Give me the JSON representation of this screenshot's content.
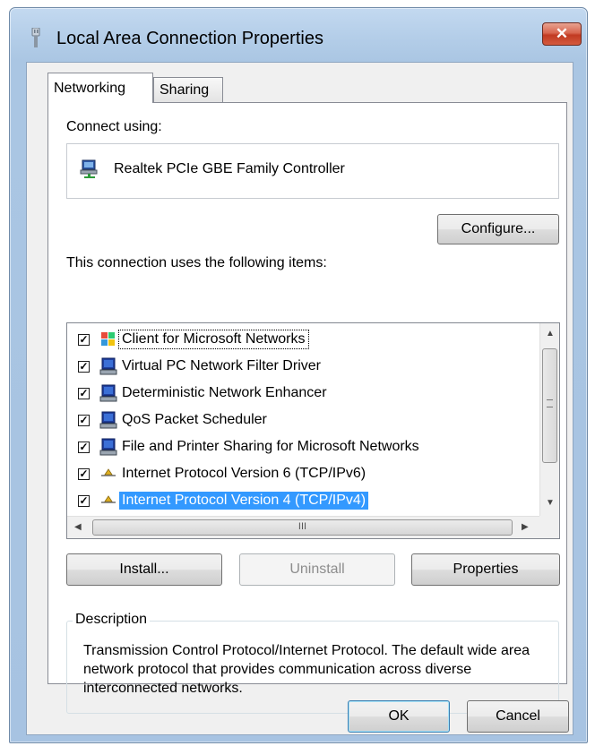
{
  "window": {
    "title": "Local Area Connection Properties",
    "close_glyph": "✕"
  },
  "tabs": [
    {
      "label": "Networking",
      "active": true
    },
    {
      "label": "Sharing",
      "active": false
    }
  ],
  "connect_using": {
    "label": "Connect using:",
    "adapter": "Realtek PCIe GBE Family Controller",
    "adapter_icon": "network-adapter-icon"
  },
  "configure_button": "Configure...",
  "items_label": "This connection uses the following items:",
  "items": [
    {
      "label": "Client for Microsoft Networks",
      "checked": true,
      "icon": "network-client-icon"
    },
    {
      "label": "Virtual PC Network Filter Driver",
      "checked": true,
      "icon": "computer-service-icon"
    },
    {
      "label": "Deterministic Network Enhancer",
      "checked": true,
      "icon": "computer-service-icon"
    },
    {
      "label": "QoS Packet Scheduler",
      "checked": true,
      "icon": "computer-service-icon"
    },
    {
      "label": "File and Printer Sharing for Microsoft Networks",
      "checked": true,
      "icon": "computer-service-icon"
    },
    {
      "label": "Internet Protocol Version 6 (TCP/IPv6)",
      "checked": true,
      "icon": "protocol-icon"
    },
    {
      "label": "Internet Protocol Version 4 (TCP/IPv4)",
      "checked": true,
      "icon": "protocol-icon",
      "selected": true
    }
  ],
  "scroll": {
    "thumb_grip": "III"
  },
  "buttons": {
    "install": "Install...",
    "uninstall": "Uninstall",
    "properties": "Properties",
    "ok": "OK",
    "cancel": "Cancel"
  },
  "description": {
    "legend": "Description",
    "text": "Transmission Control Protocol/Internet Protocol. The default wide area network protocol that provides communication across diverse interconnected networks."
  },
  "colors": {
    "selection": "#3399ff",
    "close_button": "#c13a22",
    "frame": "#a7c3e2"
  }
}
